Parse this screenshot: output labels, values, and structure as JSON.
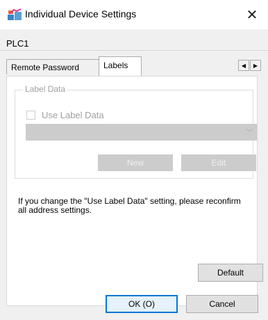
{
  "window": {
    "title": "Individual Device Settings",
    "close_glyph": "✕"
  },
  "device_name": "PLC1",
  "tabs": [
    {
      "label": "Remote Password",
      "selected": false
    },
    {
      "label": "Labels",
      "selected": true
    }
  ],
  "tab_scroll": {
    "left_glyph": "◀",
    "right_glyph": "▶"
  },
  "label_data": {
    "group_title": "Label Data",
    "use_label_data_label": "Use Label Data",
    "use_label_data_checked": false,
    "combo_value": "",
    "combo_arrow": "﹀",
    "new_label": "New",
    "edit_label": "Edit"
  },
  "info_text": "If you change the \"Use Label Data\" setting, please reconfirm all address settings.",
  "buttons": {
    "default_label": "Default",
    "ok_label": "OK (O)",
    "cancel_label": "Cancel"
  },
  "colors": {
    "disabled_fill": "#cccccc",
    "focus_border": "#0078d7"
  }
}
